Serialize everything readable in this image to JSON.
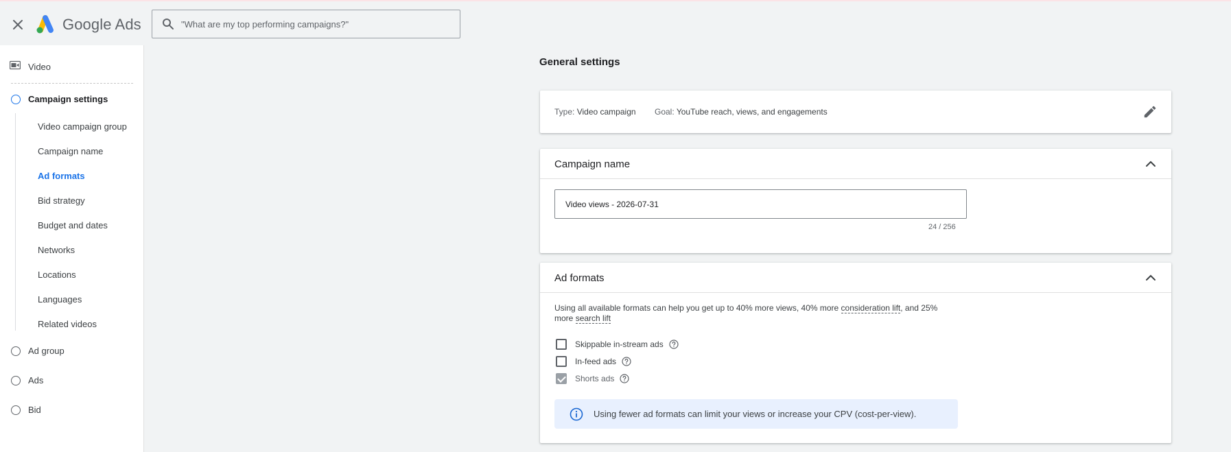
{
  "header": {
    "brand": "Google Ads",
    "search_placeholder": "\"What are my top performing campaigns?\""
  },
  "sidebar": {
    "top_item": "Video",
    "steps": [
      "Campaign settings",
      "Ad group",
      "Ads",
      "Bid"
    ],
    "sub_items": [
      "Video campaign group",
      "Campaign name",
      "Ad formats",
      "Bid strategy",
      "Budget and dates",
      "Networks",
      "Locations",
      "Languages",
      "Related videos"
    ]
  },
  "main": {
    "section_title": "General settings",
    "type_card": {
      "type_key": "Type:",
      "type_value": "Video campaign",
      "goal_key": "Goal:",
      "goal_value": "YouTube reach, views, and engagements"
    },
    "name_card": {
      "title": "Campaign name",
      "value": "Video views - 2026-07-31",
      "char_count": "24 / 256"
    },
    "formats_card": {
      "title": "Ad formats",
      "desc_part1": "Using all available formats can help you get up to 40% more views, 40% more ",
      "desc_link1": "consideration lift",
      "desc_part2": ", and 25% more ",
      "desc_link2": "search lift",
      "options": [
        "Skippable in-stream ads",
        "In-feed ads",
        "Shorts ads"
      ],
      "info": "Using fewer ad formats can limit your views or increase your CPV (cost-per-view)."
    }
  },
  "colors": {
    "accent": "#1a73e8",
    "info_bg": "#e8f0fe",
    "logo_blue": "#4285F4",
    "logo_yellow": "#FBBC04",
    "logo_green": "#34A853"
  }
}
